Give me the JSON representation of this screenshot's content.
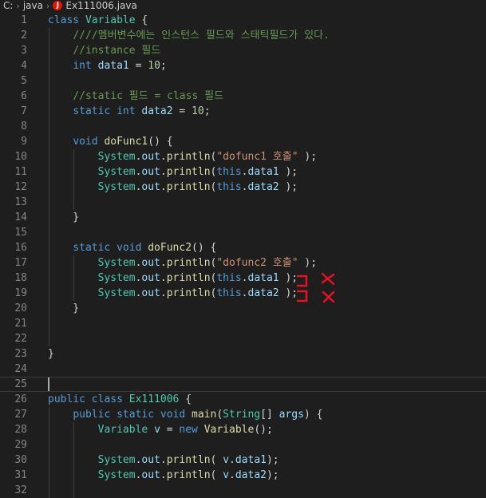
{
  "breadcrumb": {
    "root": "C:",
    "folder": "java",
    "file": "Ex111006.java",
    "file_icon_letter": "J"
  },
  "editor": {
    "lines": [
      {
        "n": "1",
        "tokens": [
          [
            "kw",
            "class "
          ],
          [
            "type",
            "Variable"
          ],
          [
            "pl",
            " {"
          ]
        ]
      },
      {
        "n": "2",
        "tokens": [
          [
            "pl",
            "    "
          ],
          [
            "cm",
            "////멤버변수에는 인스턴스 필드와 스태틱필드가 있다."
          ]
        ]
      },
      {
        "n": "3",
        "tokens": [
          [
            "pl",
            "    "
          ],
          [
            "cm",
            "//instance 필드"
          ]
        ]
      },
      {
        "n": "4",
        "tokens": [
          [
            "pl",
            "    "
          ],
          [
            "kw",
            "int "
          ],
          [
            "var",
            "data1"
          ],
          [
            "pl",
            " = "
          ],
          [
            "num",
            "10"
          ],
          [
            "pl",
            ";"
          ]
        ]
      },
      {
        "n": "5",
        "tokens": []
      },
      {
        "n": "6",
        "tokens": [
          [
            "pl",
            "    "
          ],
          [
            "cm",
            "//static 필드 = class 필드"
          ]
        ]
      },
      {
        "n": "7",
        "tokens": [
          [
            "pl",
            "    "
          ],
          [
            "kw",
            "static int "
          ],
          [
            "var",
            "data2"
          ],
          [
            "pl",
            " = "
          ],
          [
            "num",
            "10"
          ],
          [
            "pl",
            ";"
          ]
        ]
      },
      {
        "n": "8",
        "tokens": []
      },
      {
        "n": "9",
        "tokens": [
          [
            "pl",
            "    "
          ],
          [
            "kw",
            "void "
          ],
          [
            "fn",
            "doFunc1"
          ],
          [
            "pl",
            "() {"
          ]
        ]
      },
      {
        "n": "10",
        "tokens": [
          [
            "pl",
            "        "
          ],
          [
            "type",
            "System"
          ],
          [
            "pl",
            "."
          ],
          [
            "var",
            "out"
          ],
          [
            "pl",
            "."
          ],
          [
            "fn",
            "println"
          ],
          [
            "pl",
            "("
          ],
          [
            "str",
            "\"dofunc1 호출\""
          ],
          [
            "pl",
            " );"
          ]
        ]
      },
      {
        "n": "11",
        "tokens": [
          [
            "pl",
            "        "
          ],
          [
            "type",
            "System"
          ],
          [
            "pl",
            "."
          ],
          [
            "var",
            "out"
          ],
          [
            "pl",
            "."
          ],
          [
            "fn",
            "println"
          ],
          [
            "pl",
            "("
          ],
          [
            "kw",
            "this"
          ],
          [
            "pl",
            "."
          ],
          [
            "var",
            "data1"
          ],
          [
            "pl",
            " );"
          ]
        ]
      },
      {
        "n": "12",
        "tokens": [
          [
            "pl",
            "        "
          ],
          [
            "type",
            "System"
          ],
          [
            "pl",
            "."
          ],
          [
            "var",
            "out"
          ],
          [
            "pl",
            "."
          ],
          [
            "fn",
            "println"
          ],
          [
            "pl",
            "("
          ],
          [
            "kw",
            "this"
          ],
          [
            "pl",
            "."
          ],
          [
            "var",
            "data2"
          ],
          [
            "pl",
            " );"
          ]
        ]
      },
      {
        "n": "13",
        "tokens": []
      },
      {
        "n": "14",
        "tokens": [
          [
            "pl",
            "    }"
          ]
        ]
      },
      {
        "n": "15",
        "tokens": []
      },
      {
        "n": "16",
        "tokens": [
          [
            "pl",
            "    "
          ],
          [
            "kw",
            "static void "
          ],
          [
            "fn",
            "doFunc2"
          ],
          [
            "pl",
            "() {"
          ]
        ]
      },
      {
        "n": "17",
        "tokens": [
          [
            "pl",
            "        "
          ],
          [
            "type",
            "System"
          ],
          [
            "pl",
            "."
          ],
          [
            "var",
            "out"
          ],
          [
            "pl",
            "."
          ],
          [
            "fn",
            "println"
          ],
          [
            "pl",
            "("
          ],
          [
            "str",
            "\"dofunc2 호출\""
          ],
          [
            "pl",
            " );"
          ]
        ]
      },
      {
        "n": "18",
        "tokens": [
          [
            "pl",
            "        "
          ],
          [
            "type",
            "System"
          ],
          [
            "pl",
            "."
          ],
          [
            "var",
            "out"
          ],
          [
            "pl",
            "."
          ],
          [
            "fn",
            "println"
          ],
          [
            "pl",
            "("
          ],
          [
            "kw",
            "this"
          ],
          [
            "pl",
            "."
          ],
          [
            "var",
            "data1"
          ],
          [
            "pl",
            " );"
          ]
        ]
      },
      {
        "n": "19",
        "tokens": [
          [
            "pl",
            "        "
          ],
          [
            "type",
            "System"
          ],
          [
            "pl",
            "."
          ],
          [
            "var",
            "out"
          ],
          [
            "pl",
            "."
          ],
          [
            "fn",
            "println"
          ],
          [
            "pl",
            "("
          ],
          [
            "kw",
            "this"
          ],
          [
            "pl",
            "."
          ],
          [
            "var",
            "data2"
          ],
          [
            "pl",
            " );"
          ]
        ]
      },
      {
        "n": "20",
        "tokens": [
          [
            "pl",
            "    }"
          ]
        ]
      },
      {
        "n": "21",
        "tokens": []
      },
      {
        "n": "22",
        "tokens": []
      },
      {
        "n": "23",
        "tokens": [
          [
            "pl",
            "}"
          ]
        ]
      },
      {
        "n": "24",
        "tokens": []
      },
      {
        "n": "25",
        "tokens": [],
        "current": true
      },
      {
        "n": "26",
        "tokens": [
          [
            "kw",
            "public class "
          ],
          [
            "type",
            "Ex111006"
          ],
          [
            "pl",
            " {"
          ]
        ]
      },
      {
        "n": "27",
        "tokens": [
          [
            "pl",
            "    "
          ],
          [
            "kw",
            "public static void "
          ],
          [
            "fn",
            "main"
          ],
          [
            "pl",
            "("
          ],
          [
            "type",
            "String"
          ],
          [
            "pl",
            "[] "
          ],
          [
            "var",
            "args"
          ],
          [
            "pl",
            ") {"
          ]
        ]
      },
      {
        "n": "28",
        "tokens": [
          [
            "pl",
            "        "
          ],
          [
            "type",
            "Variable"
          ],
          [
            "pl",
            " "
          ],
          [
            "var",
            "v"
          ],
          [
            "pl",
            " = "
          ],
          [
            "kw",
            "new "
          ],
          [
            "fn",
            "Variable"
          ],
          [
            "pl",
            "();"
          ]
        ]
      },
      {
        "n": "29",
        "tokens": []
      },
      {
        "n": "30",
        "tokens": [
          [
            "pl",
            "        "
          ],
          [
            "type",
            "System"
          ],
          [
            "pl",
            "."
          ],
          [
            "var",
            "out"
          ],
          [
            "pl",
            "."
          ],
          [
            "fn",
            "println"
          ],
          [
            "pl",
            "( "
          ],
          [
            "var",
            "v"
          ],
          [
            "pl",
            "."
          ],
          [
            "var",
            "data1"
          ],
          [
            "pl",
            ");"
          ]
        ]
      },
      {
        "n": "31",
        "tokens": [
          [
            "pl",
            "        "
          ],
          [
            "type",
            "System"
          ],
          [
            "pl",
            "."
          ],
          [
            "var",
            "out"
          ],
          [
            "pl",
            "."
          ],
          [
            "fn",
            "println"
          ],
          [
            "pl",
            "( "
          ],
          [
            "var",
            "v"
          ],
          [
            "pl",
            "."
          ],
          [
            "var",
            "data2"
          ],
          [
            "pl",
            ");"
          ]
        ]
      },
      {
        "n": "32",
        "tokens": []
      }
    ]
  },
  "colors": {
    "background": "#1e1e1e",
    "keyword": "#569cd6",
    "type": "#4ec9b0",
    "function": "#dcdcaa",
    "variable": "#9cdcfe",
    "string": "#ce9178",
    "number": "#b5cea8",
    "comment": "#6a9955",
    "annotation": "#e81123"
  }
}
